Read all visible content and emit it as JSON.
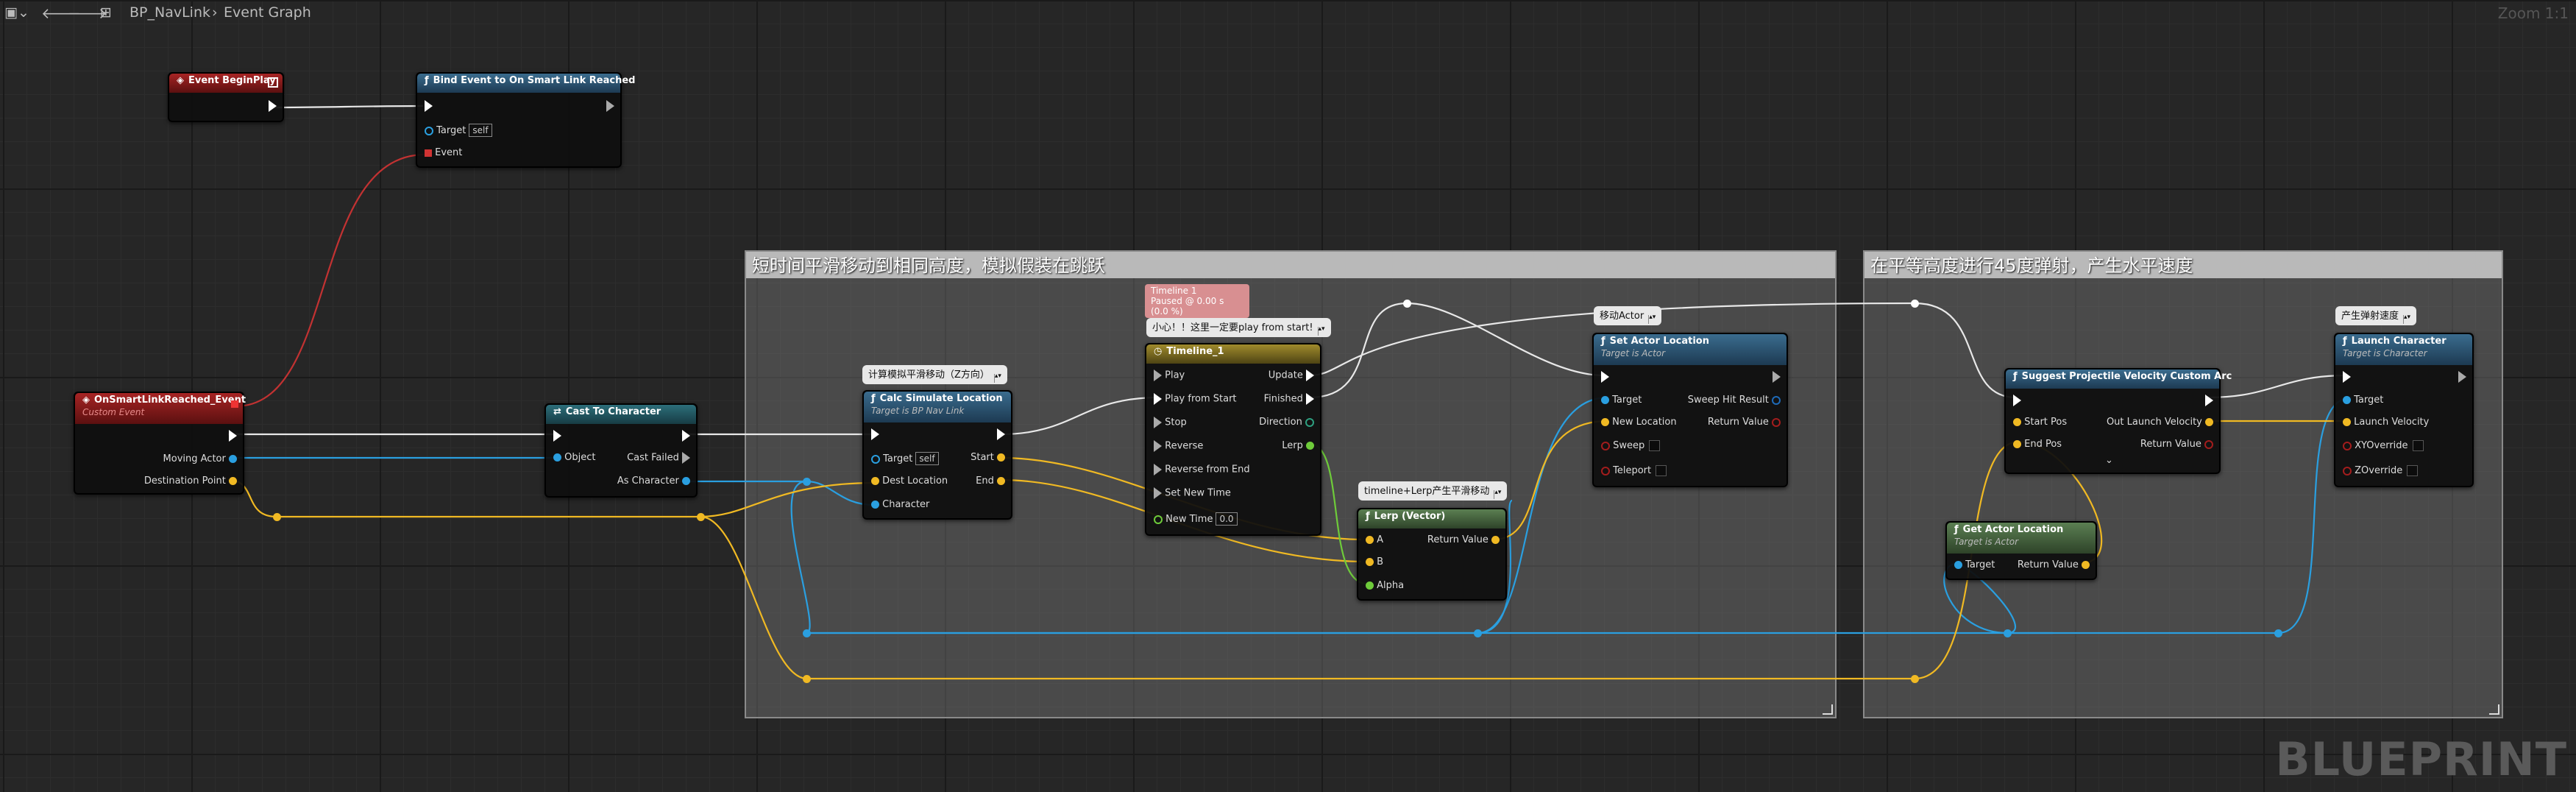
{
  "toolbar": {
    "graph_name": "BP_NavLink",
    "separator": "›",
    "graph_section": "Event Graph",
    "zoom": "Zoom 1:1"
  },
  "watermark": "BLUEPRINT",
  "colors": {
    "exec": "#ffffff",
    "object": "#29a8e8",
    "vector": "#f5c023",
    "float": "#7ad43c",
    "bool": "#a31d1d",
    "event_header": "#8e1c1c",
    "function_header": "#2f5b7a",
    "pure_header": "#4d6d46",
    "timeline_header": "#7a6c25"
  },
  "comments": [
    {
      "title": "短时间平滑移动到相同高度，模拟假装在跳跃"
    },
    {
      "title": "在平等高度进行45度弹射，产生水平速度"
    }
  ],
  "nodes": {
    "begin_play": {
      "title": "Event BeginPlay"
    },
    "bind_event": {
      "title": "Bind Event to On Smart Link Reached",
      "target": "Target",
      "target_val": "self",
      "event": "Event"
    },
    "on_smart": {
      "title": "OnSmartLinkReached_Event",
      "subtitle": "Custom Event",
      "moving_actor": "Moving Actor",
      "destination": "Destination Point"
    },
    "cast": {
      "title": "Cast To Character",
      "object": "Object",
      "cast_failed": "Cast Failed",
      "as_character": "As Character"
    },
    "calc": {
      "comment": "计算模拟平滑移动（Z方向）",
      "title": "Calc Simulate Location",
      "subtitle": "Target is BP Nav Link",
      "target": "Target",
      "target_val": "self",
      "dest": "Dest Location",
      "character": "Character",
      "start": "Start",
      "end": "End"
    },
    "timeline": {
      "status": "Timeline 1",
      "status2": "Paused @ 0.00 s (0.0 %)",
      "comment": "小心！！这里一定要play from start!",
      "title": "Timeline_1",
      "play": "Play",
      "play_from_start": "Play from Start",
      "stop": "Stop",
      "reverse": "Reverse",
      "reverse_from_end": "Reverse from End",
      "set_new_time": "Set New Time",
      "new_time": "New Time",
      "new_time_val": "0.0",
      "update": "Update",
      "finished": "Finished",
      "direction": "Direction",
      "lerp": "Lerp"
    },
    "lerp": {
      "comment": "timeline+Lerp产生平滑移动",
      "title": "Lerp (Vector)",
      "a": "A",
      "b": "B",
      "alpha": "Alpha",
      "ret": "Return Value"
    },
    "set_actor": {
      "comment": "移动Actor",
      "title": "Set Actor Location",
      "subtitle": "Target is Actor",
      "target": "Target",
      "new_location": "New Location",
      "sweep": "Sweep",
      "teleport": "Teleport",
      "sweep_hit": "Sweep Hit Result",
      "ret": "Return Value"
    },
    "suggest": {
      "title": "Suggest Projectile Velocity Custom Arc",
      "start_pos": "Start Pos",
      "end_pos": "End Pos",
      "out_launch": "Out Launch Velocity",
      "ret": "Return Value",
      "more": "⌄"
    },
    "get_actor": {
      "title": "Get Actor Location",
      "subtitle": "Target is Actor",
      "target": "Target",
      "ret": "Return Value"
    },
    "launch": {
      "comment": "产生弹射速度",
      "title": "Launch Character",
      "subtitle": "Target is Character",
      "target": "Target",
      "launch_velocity": "Launch Velocity",
      "xy": "XYOverride",
      "z": "ZOverride"
    }
  }
}
